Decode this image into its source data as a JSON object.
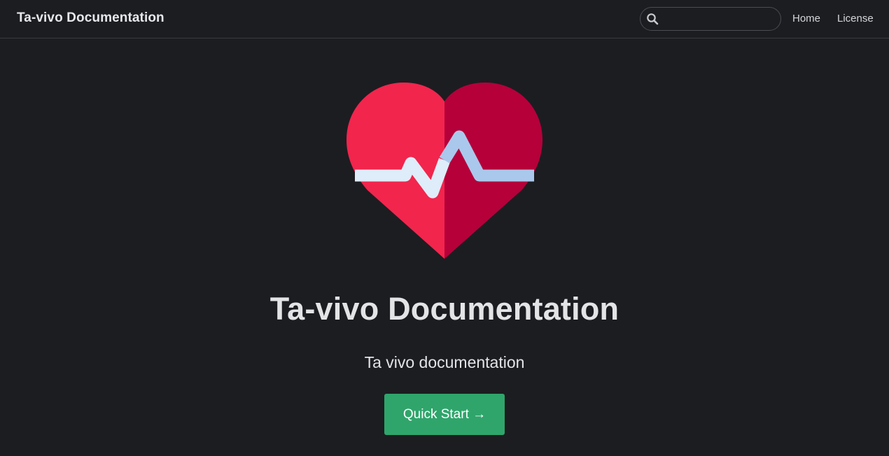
{
  "navbar": {
    "brand": "Ta-vivo Documentation",
    "search": {
      "placeholder": "",
      "value": "",
      "icon": "search-icon"
    },
    "links": [
      {
        "label": "Home"
      },
      {
        "label": "License"
      }
    ]
  },
  "hero": {
    "logo_icon": "heart-pulse-icon",
    "title": "Ta-vivo Documentation",
    "subtitle": "Ta vivo documentation",
    "cta_label": "Quick Start →"
  },
  "colors": {
    "background": "#1c1d21",
    "heart_left": "#f2254d",
    "heart_right": "#b5003a",
    "pulse_left": "#deedf9",
    "pulse_right": "#aac8ec",
    "cta": "#2fa56b"
  }
}
